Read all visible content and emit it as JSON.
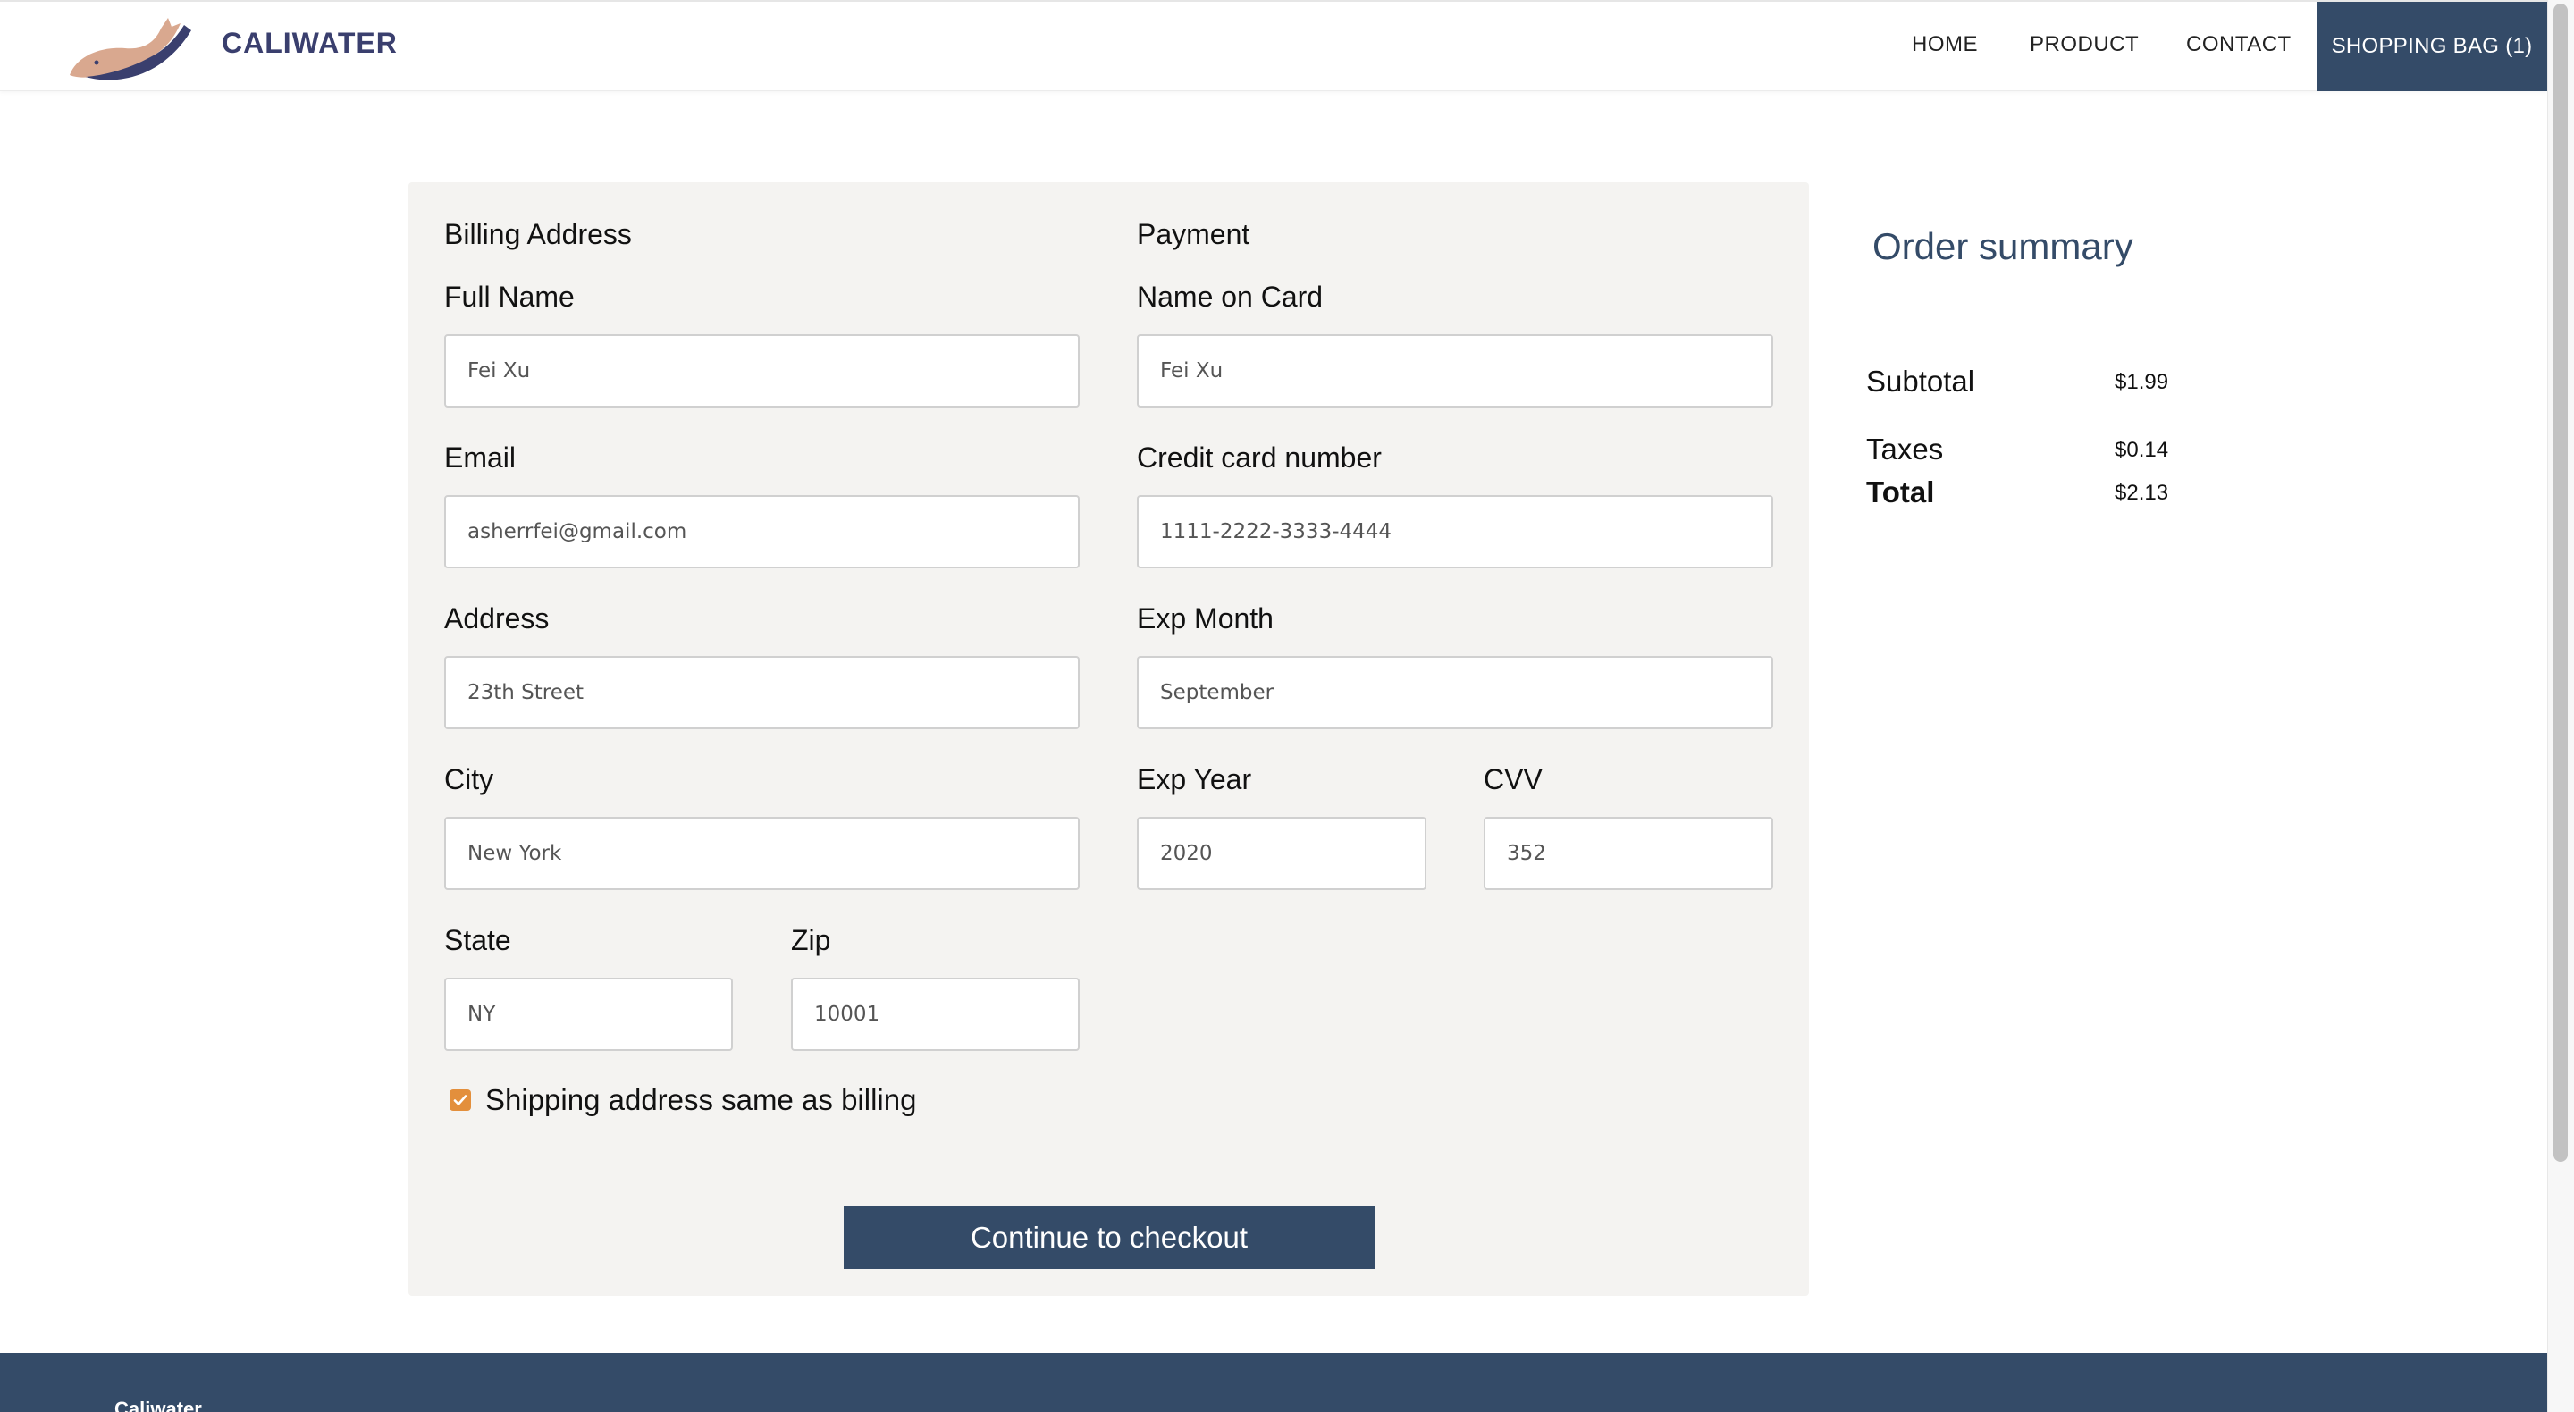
{
  "header": {
    "brand": "CALIWATER",
    "nav": {
      "home": "HOME",
      "product": "PRODUCT",
      "contact": "CONTACT",
      "bag": "SHOPPING BAG (1)"
    }
  },
  "billing": {
    "title": "Billing Address",
    "full_name": {
      "label": "Full Name",
      "value": "Fei Xu"
    },
    "email": {
      "label": "Email",
      "value": "asherrfei@gmail.com"
    },
    "address": {
      "label": "Address",
      "value": "23th Street"
    },
    "city": {
      "label": "City",
      "value": "New York"
    },
    "state": {
      "label": "State",
      "value": "NY"
    },
    "zip": {
      "label": "Zip",
      "value": "10001"
    },
    "same_as_billing": "Shipping address same as billing"
  },
  "payment": {
    "title": "Payment",
    "name_on_card": {
      "label": "Name on Card",
      "value": "Fei Xu"
    },
    "card_number": {
      "label": "Credit card number",
      "value": "1111-2222-3333-4444"
    },
    "exp_month": {
      "label": "Exp Month",
      "value": "September"
    },
    "exp_year": {
      "label": "Exp Year",
      "value": "2020"
    },
    "cvv": {
      "label": "CVV",
      "value": "352"
    }
  },
  "checkout_button": "Continue to checkout",
  "summary": {
    "title": "Order summary",
    "subtotal_label": "Subtotal",
    "subtotal_value": "$1.99",
    "taxes_label": "Taxes",
    "taxes_value": "$0.14",
    "total_label": "Total",
    "total_value": "$2.13"
  },
  "footer": {
    "brand": "Caliwater"
  },
  "colors": {
    "primary": "#344b68",
    "panel": "#f4f3f1",
    "checkbox": "#e38f3c",
    "brand_text": "#3a3f6e"
  }
}
